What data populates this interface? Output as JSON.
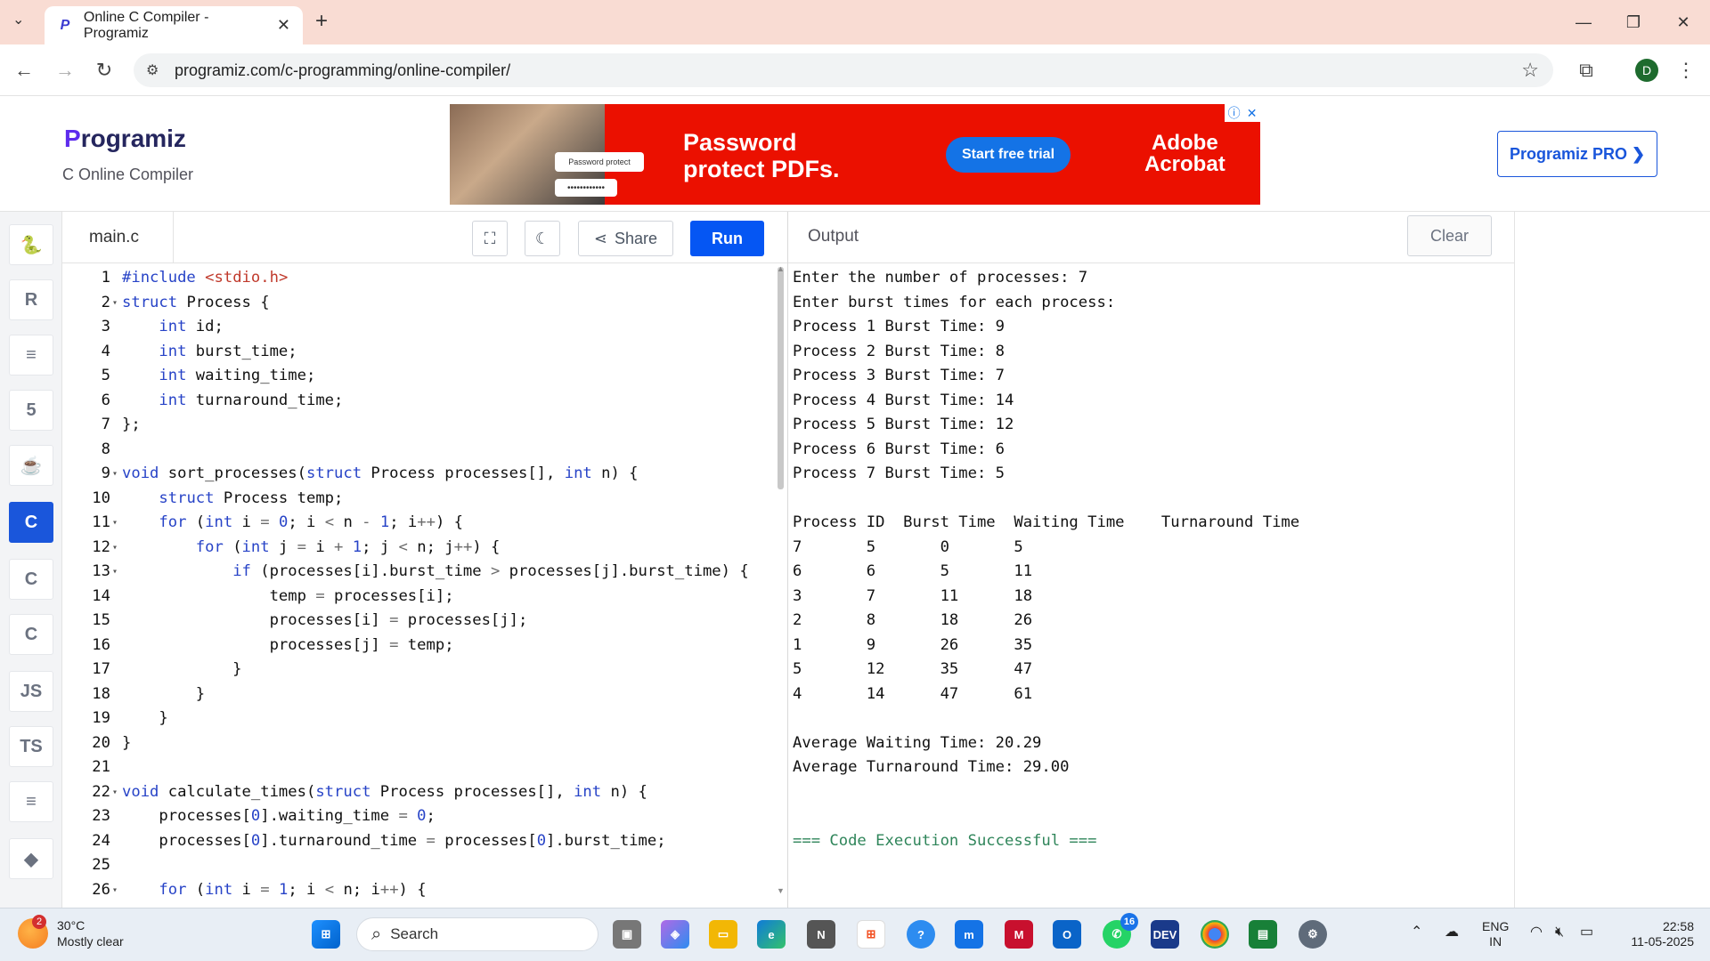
{
  "browser": {
    "tab_title": "Online C Compiler - Programiz",
    "url": "programiz.com/c-programming/online-compiler/",
    "profile_initial": "D"
  },
  "header": {
    "logo_text": "Programiz",
    "subtitle": "C Online Compiler",
    "pro_button": "Programiz PRO ❯"
  },
  "ad": {
    "pill1": "Password protect",
    "pill2": "••••••••••••",
    "headline_line1": "Password",
    "headline_line2": "protect PDFs.",
    "cta": "Start free trial",
    "brand_line1": "Adobe",
    "brand_line2": "Acrobat"
  },
  "sidebar": {
    "items": [
      {
        "name": "python",
        "label": "🐍"
      },
      {
        "name": "r",
        "label": "R"
      },
      {
        "name": "sql",
        "label": "≡"
      },
      {
        "name": "html",
        "label": "5"
      },
      {
        "name": "java",
        "label": "☕"
      },
      {
        "name": "c",
        "label": "C",
        "active": true
      },
      {
        "name": "cpp",
        "label": "C"
      },
      {
        "name": "csharp",
        "label": "C"
      },
      {
        "name": "js",
        "label": "JS"
      },
      {
        "name": "ts",
        "label": "TS"
      },
      {
        "name": "go",
        "label": "≡"
      },
      {
        "name": "swift",
        "label": "◆"
      }
    ]
  },
  "editor": {
    "filename": "main.c",
    "share_label": "Share",
    "run_label": "Run",
    "lines": [
      "#include <stdio.h>",
      "struct Process {",
      "    int id;",
      "    int burst_time;",
      "    int waiting_time;",
      "    int turnaround_time;",
      "};",
      "",
      "void sort_processes(struct Process processes[], int n) {",
      "    struct Process temp;",
      "    for (int i = 0; i < n - 1; i++) {",
      "        for (int j = i + 1; j < n; j++) {",
      "            if (processes[i].burst_time > processes[j].burst_time) {",
      "                temp = processes[i];",
      "                processes[i] = processes[j];",
      "                processes[j] = temp;",
      "            }",
      "        }",
      "    }",
      "}",
      "",
      "void calculate_times(struct Process processes[], int n) {",
      "    processes[0].waiting_time = 0;",
      "    processes[0].turnaround_time = processes[0].burst_time;",
      "",
      "    for (int i = 1; i < n; i++) {"
    ],
    "fold_lines": [
      2,
      9,
      11,
      12,
      13,
      22,
      26
    ]
  },
  "output": {
    "title": "Output",
    "clear_label": "Clear",
    "lines": [
      "Enter the number of processes: 7",
      "Enter burst times for each process:",
      "Process 1 Burst Time: 9",
      "Process 2 Burst Time: 8",
      "Process 3 Burst Time: 7",
      "Process 4 Burst Time: 14",
      "Process 5 Burst Time: 12",
      "Process 6 Burst Time: 6",
      "Process 7 Burst Time: 5",
      "",
      "Process ID  Burst Time  Waiting Time    Turnaround Time",
      "7       5       0       5",
      "6       6       5       11",
      "3       7       11      18",
      "2       8       18      26",
      "1       9       26      35",
      "5       12      35      47",
      "4       14      47      61",
      "",
      "Average Waiting Time: 20.29",
      "Average Turnaround Time: 29.00",
      "",
      "",
      "=== Code Execution Successful ==="
    ]
  },
  "taskbar": {
    "weather_badge": "2",
    "temperature": "30°C",
    "condition": "Mostly clear",
    "search_label": "Search",
    "whatsapp_badge": "16",
    "language_line1": "ENG",
    "language_line2": "IN",
    "time": "22:58",
    "date": "11-05-2025"
  }
}
